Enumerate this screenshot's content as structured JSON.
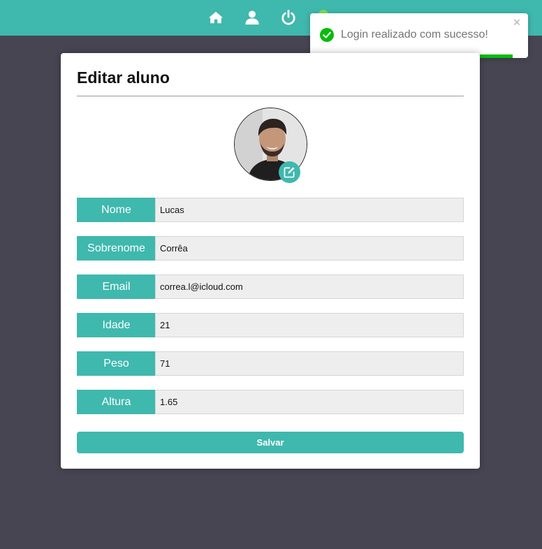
{
  "nav": {
    "icons": [
      "home-icon",
      "user-icon",
      "power-icon",
      "status-dot"
    ],
    "status_color": "#7be34f"
  },
  "toast": {
    "message": "Login realizado com sucesso!",
    "close_symbol": "×",
    "progress": 0.93,
    "accent": "#07bc0c"
  },
  "form": {
    "title": "Editar aluno",
    "fields": [
      {
        "label": "Nome",
        "value": "Lucas"
      },
      {
        "label": "Sobrenome",
        "value": "Corrêa"
      },
      {
        "label": "Email",
        "value": "correa.l@icloud.com"
      },
      {
        "label": "Idade",
        "value": "21"
      },
      {
        "label": "Peso",
        "value": "71"
      },
      {
        "label": "Altura",
        "value": "1.65"
      }
    ],
    "save_label": "Salvar"
  },
  "theme": {
    "accent": "#3fb8ae",
    "background": "#484552"
  }
}
